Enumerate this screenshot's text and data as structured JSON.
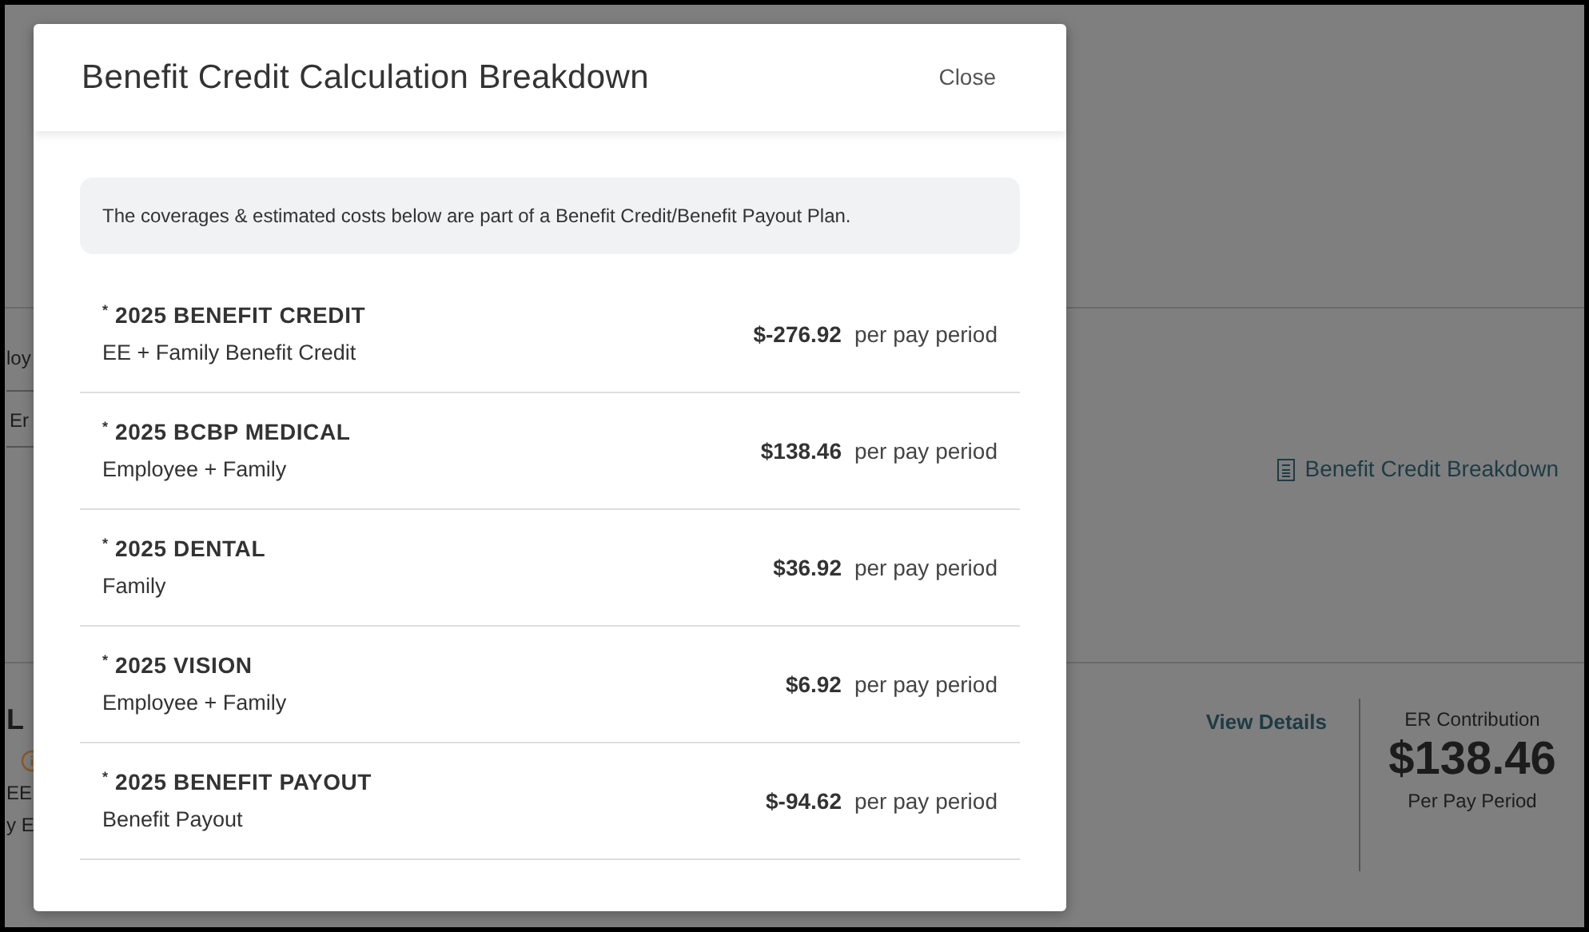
{
  "background": {
    "employee_fragment": "loy",
    "tab_fragment": "Er",
    "breakdown_link": "Benefit Credit Breakdown",
    "plan_fragments": [
      "L",
      "EE",
      "y E"
    ],
    "view_details": "View Details",
    "er_contribution": {
      "label": "ER Contribution",
      "amount": "$138.46",
      "period": "Per Pay Period"
    }
  },
  "modal": {
    "title": "Benefit Credit Calculation Breakdown",
    "close": "Close",
    "notice": "The coverages & estimated costs below are part of a Benefit Credit/Benefit Payout Plan.",
    "rows": [
      {
        "name": "$^{*}$ 2025 BENEFIT CREDIT",
        "detail": "EE + Family Benefit Credit",
        "amount": "$-276.92",
        "period": "per pay period"
      },
      {
        "name": "$^{*}$ 2025 BCBP MEDICAL",
        "detail": "Employee + Family",
        "amount": "$138.46",
        "period": "per pay period"
      },
      {
        "name": "$^{*}$ 2025 DENTAL",
        "detail": "Family",
        "amount": "$36.92",
        "period": "per pay period"
      },
      {
        "name": "$^{*}$ 2025 VISION",
        "detail": "Employee + Family",
        "amount": "$6.92",
        "period": "per pay period"
      },
      {
        "name": "$^{*}$ 2025 BENEFIT PAYOUT",
        "detail": "Benefit Payout",
        "amount": "$-94.62",
        "period": "per pay period"
      }
    ]
  }
}
